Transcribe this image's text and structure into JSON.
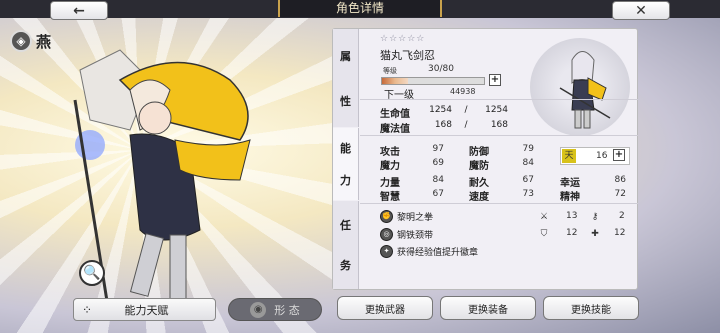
{
  "header": {
    "title": "角色详情"
  },
  "character": {
    "name": "燕",
    "subname": "猫丸飞剑忍",
    "stars": "☆☆☆☆☆"
  },
  "level": {
    "label": "等级",
    "value": "30/80",
    "next_label": "下一级",
    "next_value": "44938",
    "exp_progress": 0.25
  },
  "tabs": [
    "属性",
    "能力",
    "任务"
  ],
  "vitals": [
    {
      "label": "生命值",
      "current": "1254",
      "sep": "/",
      "max": "1254"
    },
    {
      "label": "魔法值",
      "current": "168",
      "sep": "/",
      "max": "168"
    }
  ],
  "stats": [
    {
      "label": "攻击",
      "value": "97"
    },
    {
      "label": "防御",
      "value": "79"
    },
    {
      "label": "魔力",
      "value": "69"
    },
    {
      "label": "魔防",
      "value": "84"
    },
    {
      "label": "力量",
      "value": "84"
    },
    {
      "label": "耐久",
      "value": "67"
    },
    {
      "label": "幸运",
      "value": "86"
    },
    {
      "label": "智慧",
      "value": "67"
    },
    {
      "label": "速度",
      "value": "73"
    },
    {
      "label": "精神",
      "value": "72"
    }
  ],
  "rank": {
    "value": "16"
  },
  "skills": [
    {
      "name": "黎明之拳",
      "icon": "fist-icon"
    },
    {
      "name": "钢铁颈带",
      "icon": "neckband-icon"
    },
    {
      "name": "获得经验值提升徽章",
      "icon": "badge-icon"
    }
  ],
  "mini_stats": [
    {
      "icon": "sword-icon",
      "value": "13"
    },
    {
      "icon": "key-icon",
      "value": "2"
    },
    {
      "icon": "shield-icon",
      "value": "12"
    },
    {
      "icon": "cross-icon",
      "value": "12"
    }
  ],
  "buttons": {
    "talent": "能力天赋",
    "form": "形 态",
    "change_weapon": "更换武器",
    "change_equipment": "更换装备",
    "change_skill": "更换技能"
  }
}
